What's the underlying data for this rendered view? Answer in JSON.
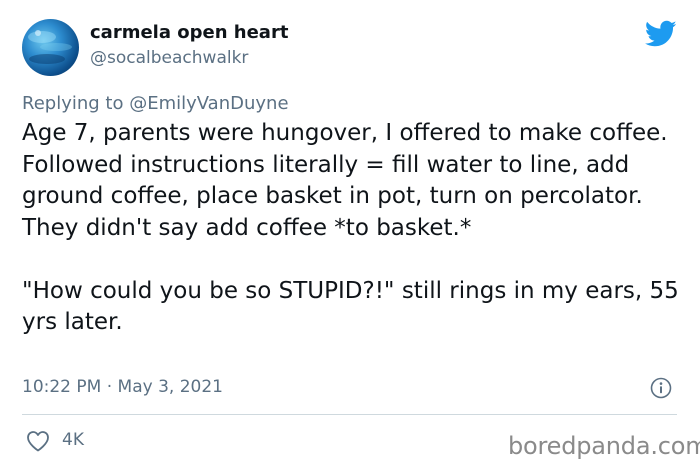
{
  "author": {
    "display_name": "carmela open heart",
    "handle": "@socalbeachwalkr"
  },
  "reply": {
    "prefix": "Replying to ",
    "mention": "@EmilyVanDuyne"
  },
  "tweet": {
    "text": "Age 7, parents were hungover, I offered to make coffee. Followed instructions literally = fill water to line, add ground coffee, place basket in pot, turn on percolator. They didn't say add coffee *to basket.*\n\n\"How could you be so STUPID?!\" still rings in my ears, 55 yrs later.",
    "timestamp": "10:22 PM · May 3, 2021"
  },
  "stats": {
    "likes": "4K"
  },
  "watermark": "boredpanda.com",
  "icons": {
    "brand": "twitter-bird-icon",
    "info": "info-icon",
    "like": "heart-icon"
  },
  "colors": {
    "twitter_blue": "#1d9bf0",
    "secondary_text": "#5b7083",
    "divider": "#cfd9de"
  }
}
